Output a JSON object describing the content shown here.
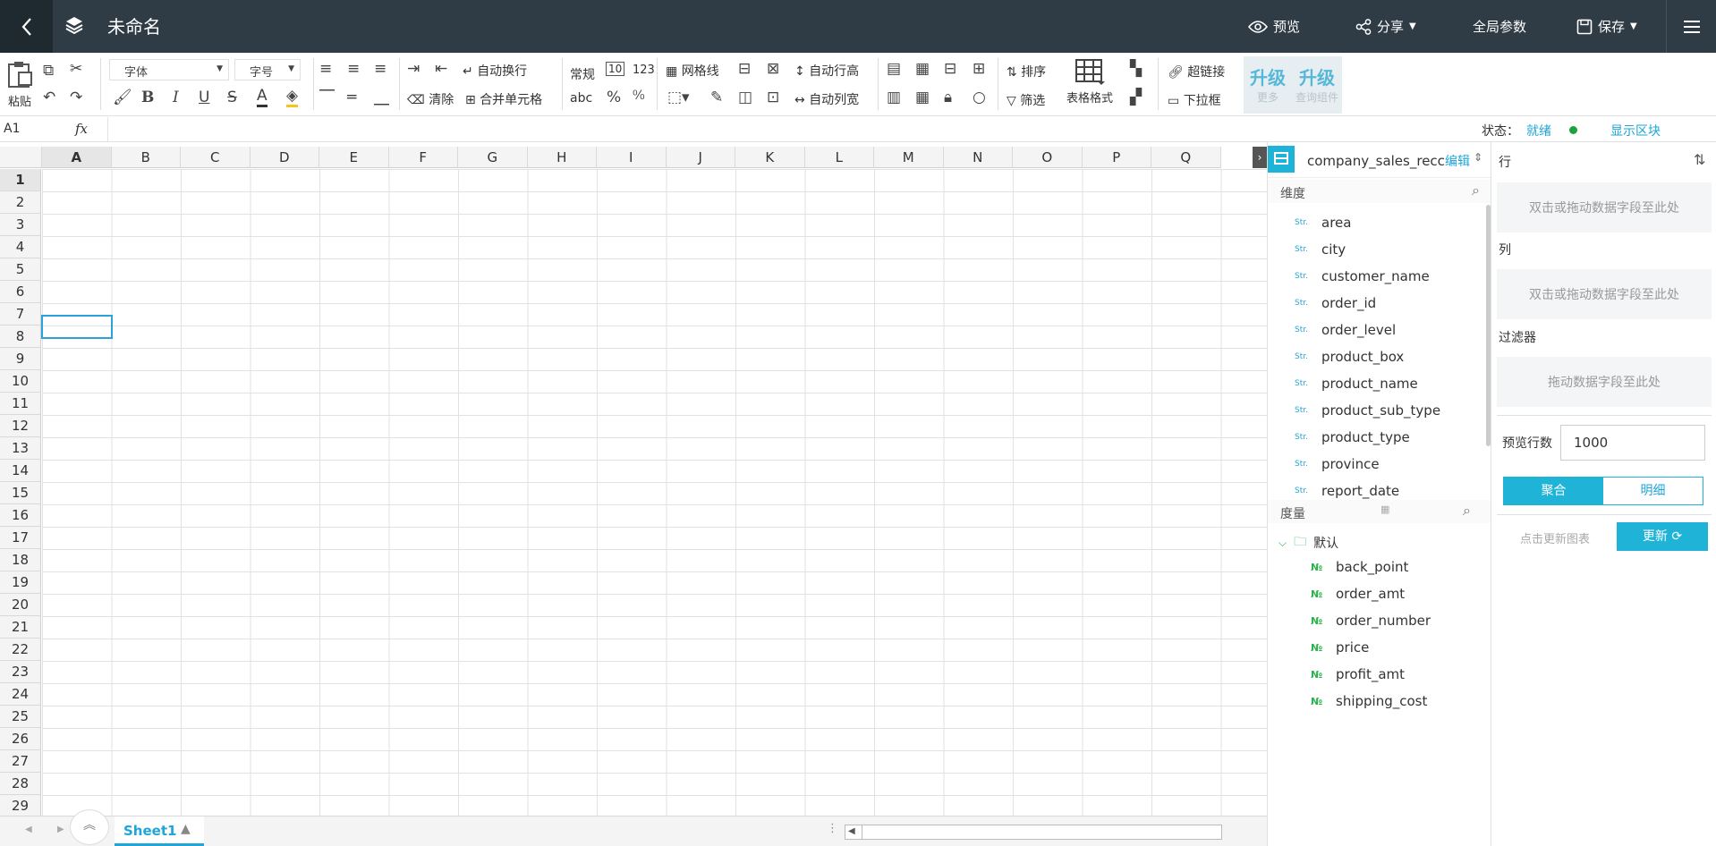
{
  "header": {
    "title": "未命名",
    "preview": "预览",
    "share": "分享",
    "global_params": "全局参数",
    "save": "保存"
  },
  "toolbar": {
    "paste": "粘贴",
    "font": "字体",
    "font_size": "字号",
    "auto_wrap": "自动换行",
    "clear": "清除",
    "merge_cells": "合并单元格",
    "normal": "常规",
    "num_10": "10",
    "num_123": "123",
    "abc": "abc",
    "gridlines": "网格线",
    "auto_row_height": "自动行高",
    "auto_col_width": "自动列宽",
    "sort": "排序",
    "filter": "筛选",
    "table_format": "表格格式",
    "hyperlink": "超链接",
    "dropdown": "下拉框",
    "upgrade1": "升级",
    "upgrade1_sub": "更多",
    "upgrade2": "升级",
    "upgrade2_sub": "查询组件"
  },
  "formula": {
    "cell_ref": "A1",
    "fx": "fx",
    "status_label": "状态：",
    "status_value": "就绪",
    "show_blocks": "显示区块"
  },
  "sheet": {
    "columns": [
      "A",
      "B",
      "C",
      "D",
      "E",
      "F",
      "G",
      "H",
      "I",
      "J",
      "K",
      "L",
      "M",
      "N",
      "O",
      "P",
      "Q"
    ],
    "rows": [
      "1",
      "2",
      "3",
      "4",
      "5",
      "6",
      "7",
      "8",
      "9",
      "10",
      "11",
      "12",
      "13",
      "14",
      "15",
      "16",
      "17",
      "18",
      "19",
      "20",
      "21",
      "22",
      "23",
      "24",
      "25",
      "26",
      "27",
      "28",
      "29"
    ],
    "tab": "Sheet1"
  },
  "fields": {
    "dataset": "company_sales_recc",
    "edit": "编辑",
    "dimensions_label": "维度",
    "dimension_type": "Str.",
    "dimensions": [
      "area",
      "city",
      "customer_name",
      "order_id",
      "order_level",
      "product_box",
      "product_name",
      "product_sub_type",
      "product_type",
      "province",
      "report_date"
    ],
    "measures_label": "度量",
    "measure_folder": "默认",
    "measure_type": "№",
    "measures": [
      "back_point",
      "order_amt",
      "order_number",
      "price",
      "profit_amt",
      "shipping_cost"
    ]
  },
  "config": {
    "row_label": "行",
    "row_drop": "双击或拖动数据字段至此处",
    "col_label": "列",
    "col_drop": "双击或拖动数据字段至此处",
    "filter_label": "过滤器",
    "filter_drop": "拖动数据字段至此处",
    "preview_rows_label": "预览行数",
    "preview_rows_value": "1000",
    "aggregate": "聚合",
    "detail": "明细",
    "click_update": "点击更新图表",
    "update": "更新"
  },
  "colors": {
    "header_bg": "#2f3b45",
    "accent": "#1fb3d8",
    "status_ok": "#1aa33a"
  }
}
